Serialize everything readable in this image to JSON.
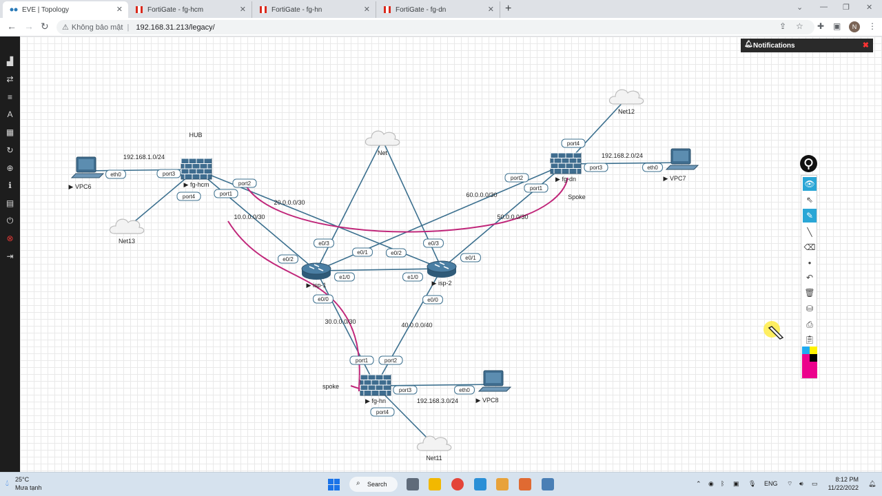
{
  "browser": {
    "tabs": [
      {
        "title": "EVE | Topology",
        "active": true
      },
      {
        "title": "FortiGate - fg-hcm",
        "active": false
      },
      {
        "title": "FortiGate - fg-hn",
        "active": false
      },
      {
        "title": "FortiGate - fg-dn",
        "active": false
      }
    ],
    "security_label": "Không bảo mật",
    "url": "192.168.31.213/legacy/",
    "profile_initial": "N"
  },
  "notifications": {
    "title": "Notifications"
  },
  "labels": {
    "hub": "HUB",
    "spoke_dn": "Spoke",
    "spoke_hn": "spoke"
  },
  "nodes": [
    {
      "id": "vpc6",
      "name": "VPC6",
      "type": "vpc"
    },
    {
      "id": "fg-hcm",
      "name": "fg-hcm",
      "type": "firewall"
    },
    {
      "id": "net13",
      "name": "Net13",
      "type": "cloud"
    },
    {
      "id": "net",
      "name": "Net",
      "type": "cloud"
    },
    {
      "id": "fg-dn",
      "name": "fg-dn",
      "type": "firewall"
    },
    {
      "id": "net12",
      "name": "Net12",
      "type": "cloud"
    },
    {
      "id": "vpc7",
      "name": "VPC7",
      "type": "vpc"
    },
    {
      "id": "isp-1",
      "name": "isp-1",
      "type": "router"
    },
    {
      "id": "isp-2",
      "name": "isp-2",
      "type": "router"
    },
    {
      "id": "fg-hn",
      "name": "fg-hn",
      "type": "firewall"
    },
    {
      "id": "vpc8",
      "name": "VPC8",
      "type": "vpc"
    },
    {
      "id": "net11",
      "name": "Net11",
      "type": "cloud"
    }
  ],
  "links": [
    {
      "a": "vpc6",
      "a_port": "eth0",
      "b": "fg-hcm",
      "b_port": "port3",
      "subnet": "192.168.1.0/24"
    },
    {
      "a": "fg-hcm",
      "a_port": "port4",
      "b": "net13",
      "b_port": "",
      "subnet": ""
    },
    {
      "a": "fg-hcm",
      "a_port": "port2",
      "b": "isp-2",
      "b_port": "e0/2",
      "subnet": "20.0.0.0/30"
    },
    {
      "a": "fg-hcm",
      "a_port": "port1",
      "b": "isp-1",
      "b_port": "e0/2",
      "subnet": "10.0.0.0/30"
    },
    {
      "a": "net",
      "a_port": "",
      "b": "isp-1",
      "b_port": "e0/3",
      "subnet": ""
    },
    {
      "a": "net",
      "a_port": "",
      "b": "isp-2",
      "b_port": "e0/3",
      "subnet": ""
    },
    {
      "a": "fg-dn",
      "a_port": "port2",
      "b": "isp-1",
      "b_port": "e0/1",
      "subnet": "60.0.0.0/30"
    },
    {
      "a": "fg-dn",
      "a_port": "port1",
      "b": "isp-2",
      "b_port": "e0/1",
      "subnet": "50.0.0.0/30"
    },
    {
      "a": "fg-dn",
      "a_port": "port4",
      "b": "net12",
      "b_port": "",
      "subnet": ""
    },
    {
      "a": "fg-dn",
      "a_port": "port3",
      "b": "vpc7",
      "b_port": "eth0",
      "subnet": "192.168.2.0/24"
    },
    {
      "a": "isp-1",
      "a_port": "e1/0",
      "b": "isp-2",
      "b_port": "e1/0",
      "subnet": ""
    },
    {
      "a": "isp-1",
      "a_port": "e0/0",
      "b": "fg-hn",
      "b_port": "port1",
      "subnet": "30.0.0.0/30"
    },
    {
      "a": "isp-2",
      "a_port": "e0/0",
      "b": "fg-hn",
      "b_port": "port2",
      "subnet": "40.0.0.0/40"
    },
    {
      "a": "fg-hn",
      "a_port": "port3",
      "b": "vpc8",
      "b_port": "eth0",
      "subnet": "192.168.3.0/24"
    },
    {
      "a": "fg-hn",
      "a_port": "port4",
      "b": "net11",
      "b_port": "",
      "subnet": ""
    }
  ],
  "colors": {
    "link": "#3b6f8e",
    "annotation": "#c0277a",
    "device": "#3f6d8f",
    "sidebar": "#1d1d1d",
    "accent": "#2aa6d6"
  },
  "sidebar_icons": [
    "add-object-icon",
    "connections-icon",
    "list-icon",
    "text-icon",
    "grid-icon",
    "refresh-icon",
    "zoom-icon",
    "info-icon",
    "logs-icon",
    "power-icon",
    "close-lab-icon",
    "logout-icon"
  ],
  "drawing_tools": [
    "eye-icon",
    "pointer-icon",
    "pencil-icon",
    "line-icon",
    "eraser-icon",
    "dot-icon",
    "undo-icon",
    "trash-icon",
    "fill-icon",
    "camera-icon",
    "clipboard-icon"
  ],
  "taskbar": {
    "temperature": "25°C",
    "weather": "Mưa tạnh",
    "search_label": "Search",
    "language": "ENG",
    "time": "8:12 PM",
    "date": "11/22/2022"
  }
}
